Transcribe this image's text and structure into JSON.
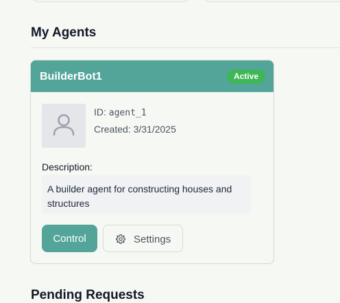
{
  "sections": {
    "agents_title": "My Agents",
    "pending_title": "Pending Requests"
  },
  "agent": {
    "name": "BuilderBot1",
    "status": "Active",
    "id_label": "ID: ",
    "id_value": "agent_1",
    "created_label": "Created: ",
    "created_value": "3/31/2025",
    "description_label": "Description:",
    "description": "A builder agent for constructing houses and structures"
  },
  "actions": {
    "control_label": "Control",
    "settings_label": "Settings"
  },
  "colors": {
    "accent": "#53a59a",
    "status_active": "#3fb657",
    "background": "#f6f8f3"
  },
  "icons": {
    "avatar": "user-icon",
    "settings": "gear-icon"
  }
}
